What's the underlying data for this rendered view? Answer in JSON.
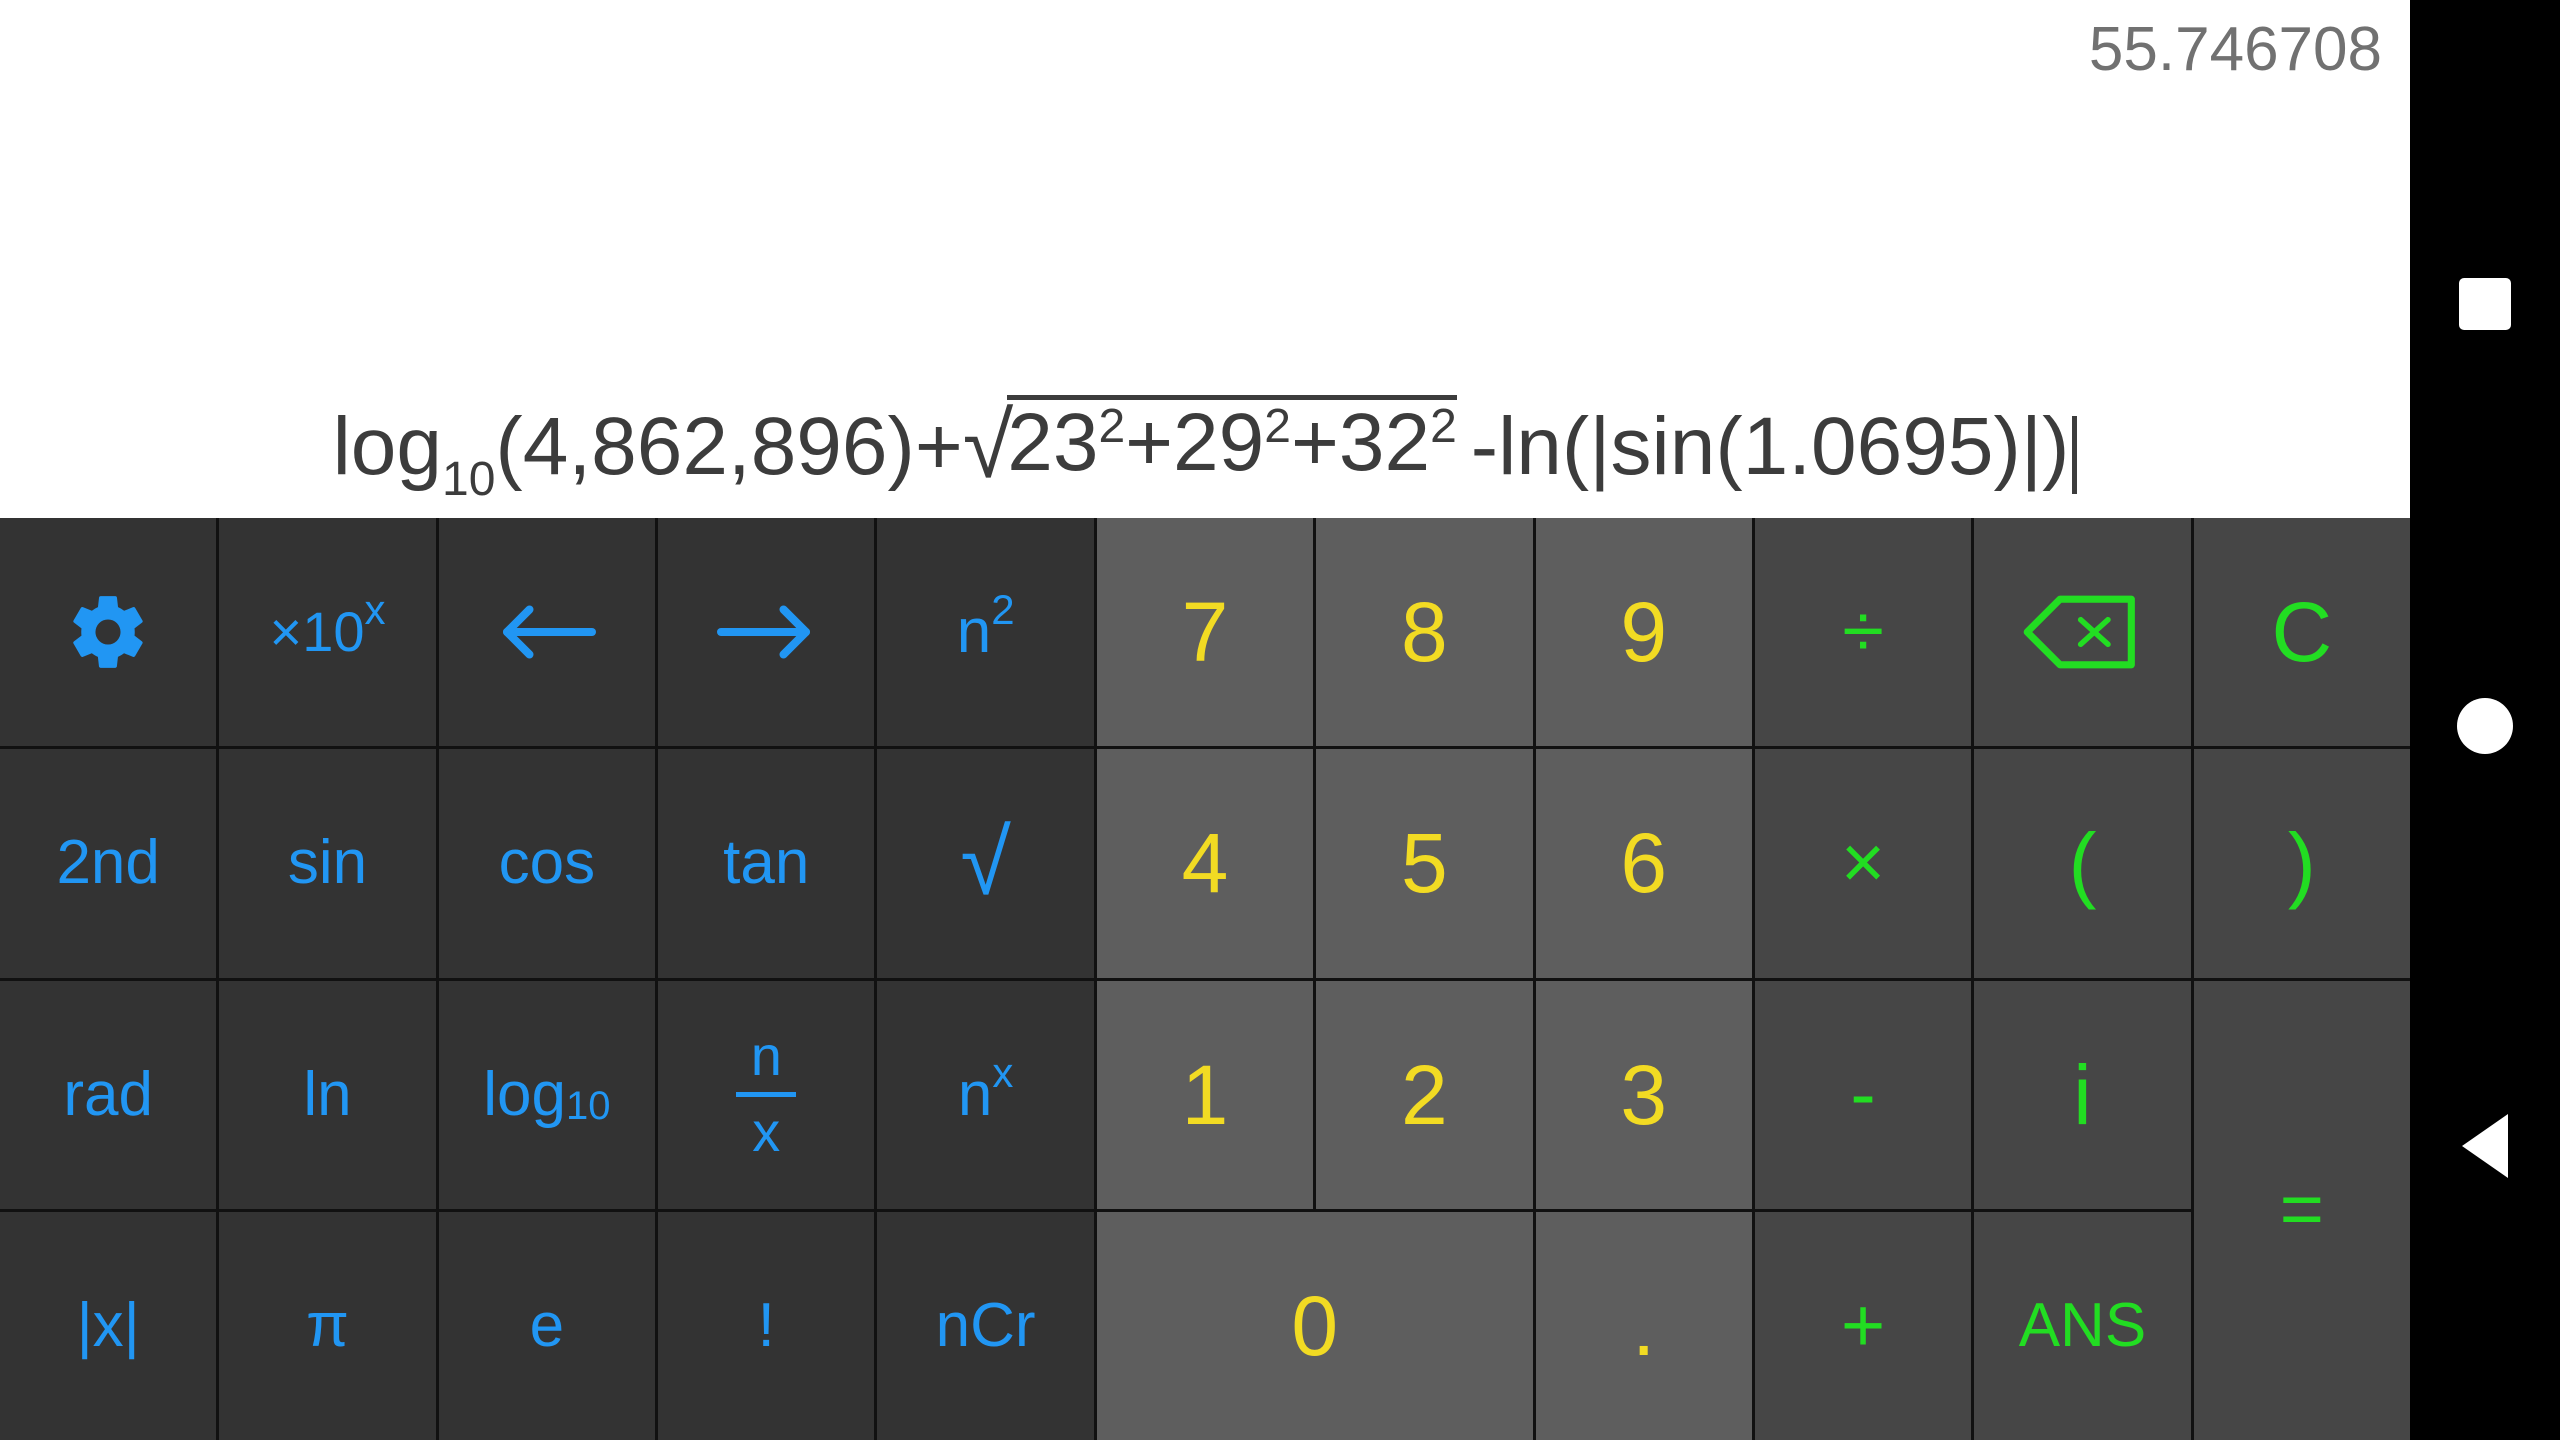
{
  "display": {
    "result": "55.746708",
    "expression_text": "log10(4,862,896)+√(23²+29²+32²) -ln(|sin(1.0695)|)",
    "expr": {
      "log_name": "log",
      "log_sub": "10",
      "log_open": "(",
      "log_arg": "4,862,896",
      "log_close": ")",
      "plus": "+",
      "radical_symbol": "√",
      "rad_a": "23",
      "rad_a_exp": "2",
      "rad_plus1": "+",
      "rad_b": "29",
      "rad_b_exp": "2",
      "rad_plus2": "+",
      "rad_c": "32",
      "rad_c_exp": "2",
      "minus": "-",
      "ln_name": "ln",
      "ln_open": "(",
      "abs_open": "|",
      "sin_name": "sin",
      "sin_open": "(",
      "sin_arg": "1.0695",
      "sin_close": ")",
      "abs_close": "|",
      "ln_close": ")"
    },
    "result_color": "#717171",
    "expression_color": "#3c3c3c",
    "background_color": "#ffffff"
  },
  "colors": {
    "function_key_bg": "#333333",
    "function_key_fg": "#2196F3",
    "number_key_bg": "#5e5e5e",
    "number_key_fg": "#F2DB23",
    "operator_key_bg": "#464646",
    "operator_key_fg": "#22DD22",
    "keypad_divider": "#111111",
    "navbar_bg": "#000000",
    "navbar_fg": "#ffffff"
  },
  "keypad": {
    "row1": {
      "settings": "settings-gear",
      "exp10": {
        "base": "×10",
        "exp": "x"
      },
      "left_arrow": "←",
      "right_arrow": "→",
      "square": {
        "base": "n",
        "exp": "2"
      },
      "seven": "7",
      "eight": "8",
      "nine": "9",
      "divide": "÷",
      "backspace": "backspace",
      "clear": "C"
    },
    "row2": {
      "second": "2nd",
      "sin": "sin",
      "cos": "cos",
      "tan": "tan",
      "sqrt": "√",
      "four": "4",
      "five": "5",
      "six": "6",
      "multiply": "×",
      "open_paren": "(",
      "close_paren": ")"
    },
    "row3": {
      "rad": "rad",
      "ln": "ln",
      "log": {
        "base": "log",
        "sub": "10"
      },
      "fraction": {
        "numerator": "n",
        "denominator": "x"
      },
      "power": {
        "base": "n",
        "exp": "x"
      },
      "one": "1",
      "two": "2",
      "three": "3",
      "minus": "-",
      "imaginary": "i",
      "equals": "="
    },
    "row4": {
      "abs": "|x|",
      "pi": "π",
      "e": "e",
      "factorial": "!",
      "ncr": "nCr",
      "zero": "0",
      "decimal": ".",
      "plus": "+",
      "ans": "ANS"
    }
  },
  "navbar": {
    "recents": "recents-square",
    "home": "home-circle",
    "back": "back-triangle"
  }
}
